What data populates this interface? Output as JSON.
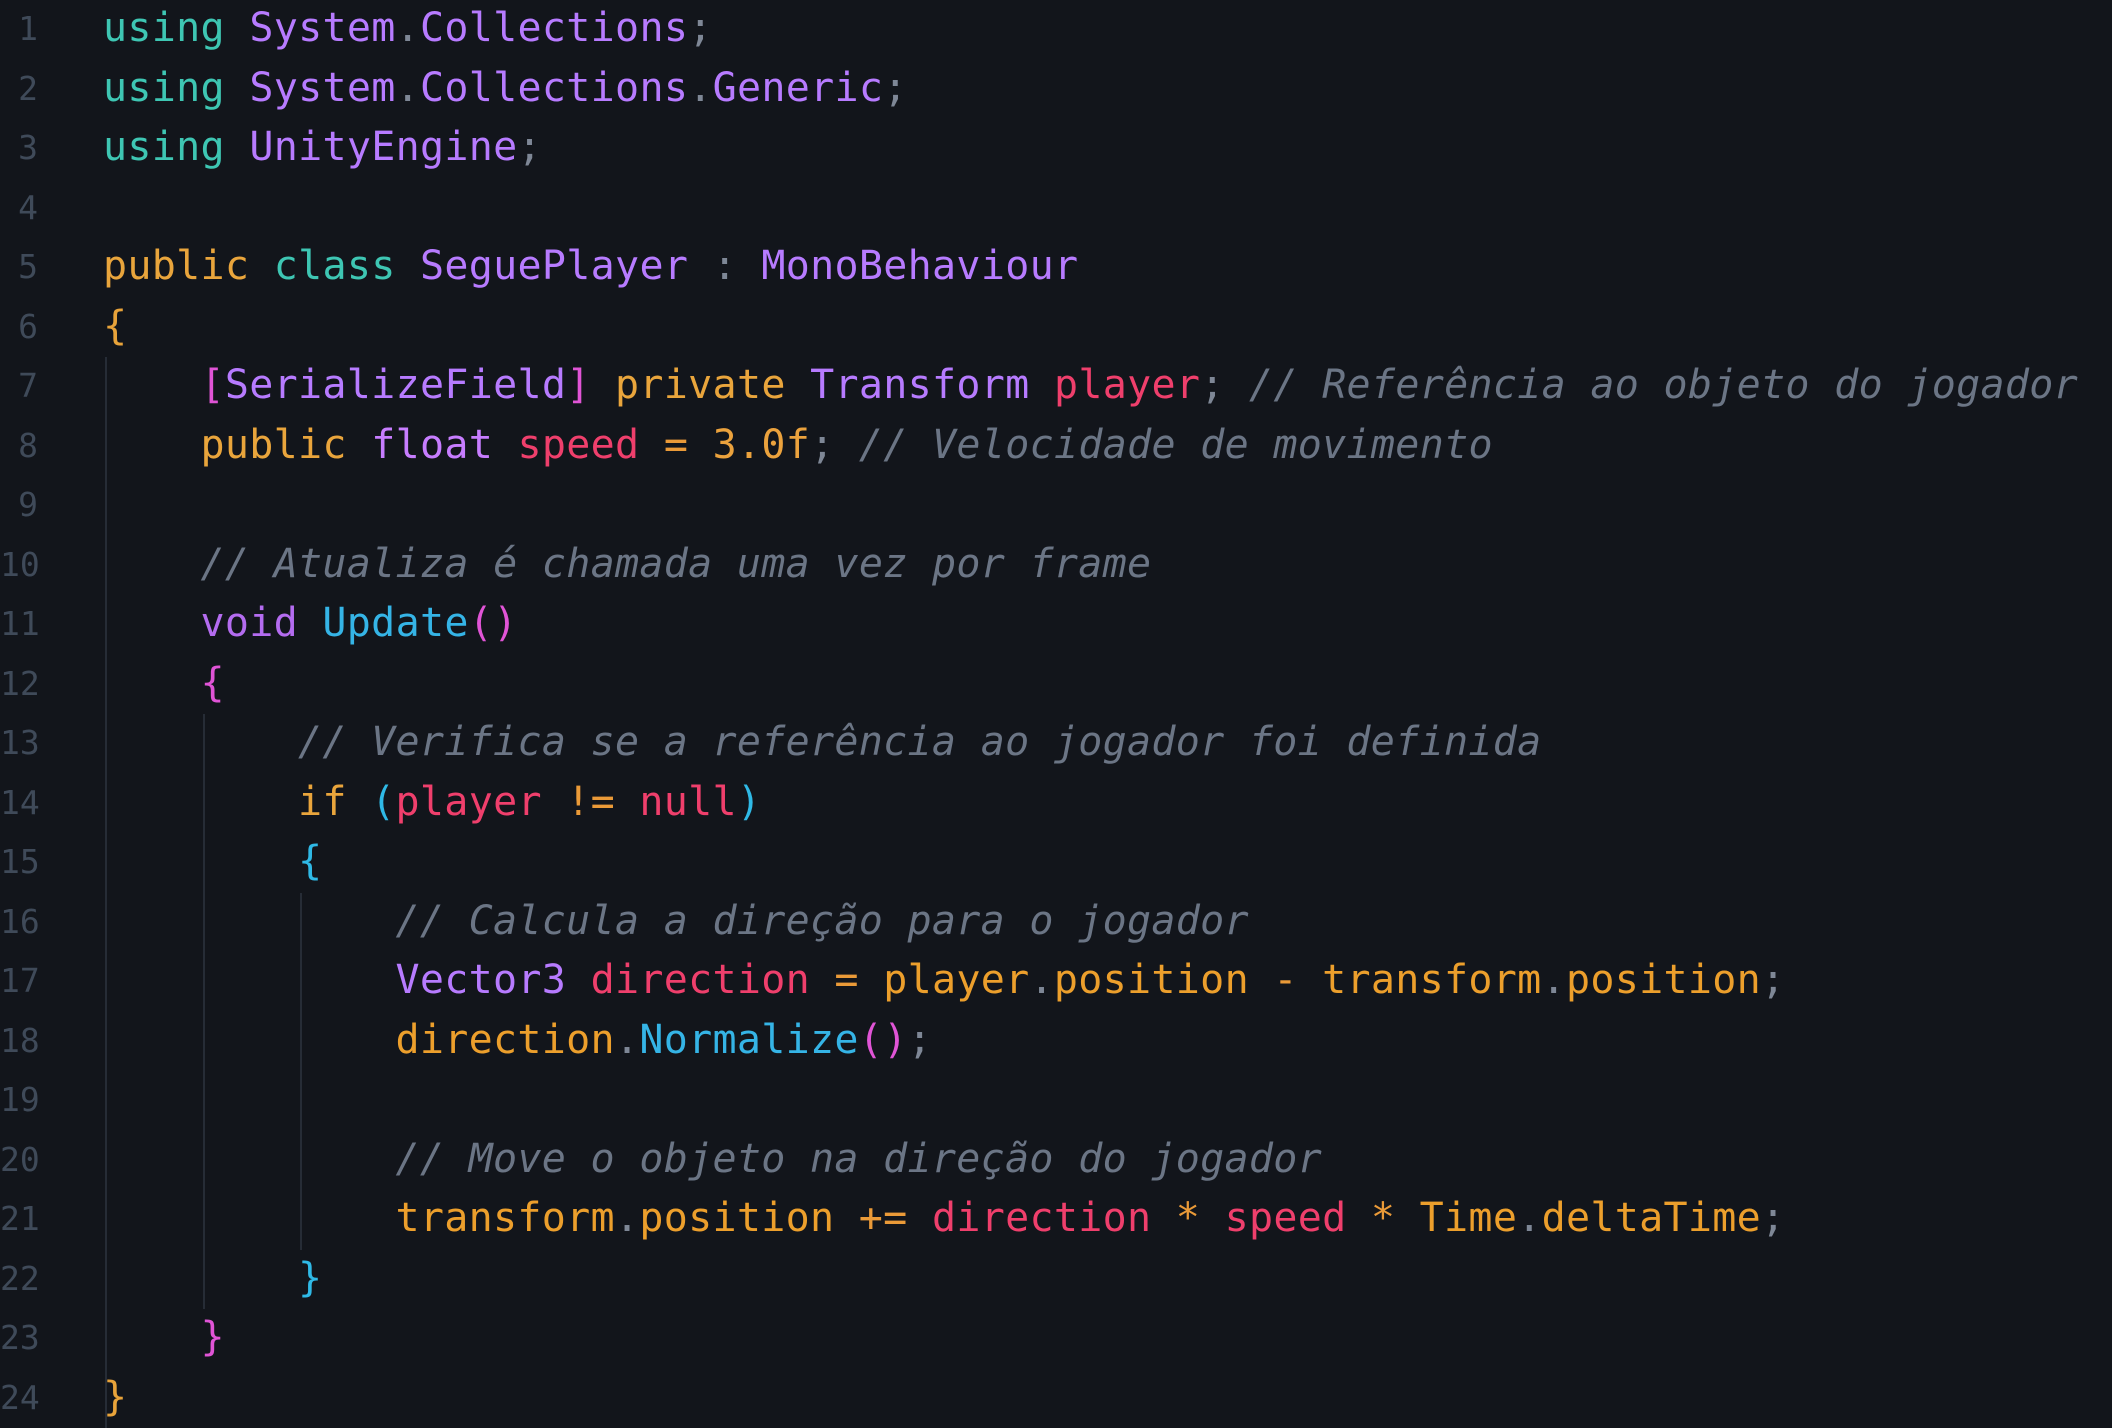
{
  "colors": {
    "background": "#12151b",
    "line_number": "#3f4a59",
    "comment": "#6b7585",
    "keyword_orange": "#e9a53c",
    "keyword_teal": "#3ec6b3",
    "type_purple": "#b77bff",
    "function_blue": "#35b4e6",
    "variable_red": "#ef3f6c",
    "property_orange": "#ec9f2c"
  },
  "lines": [
    {
      "n": "1",
      "indent": 0,
      "tokens": [
        [
          "using",
          "tk-kw-teal"
        ],
        [
          " ",
          "tk-plain"
        ],
        [
          "System",
          "tk-type"
        ],
        [
          ".",
          "tk-punc"
        ],
        [
          "Collections",
          "tk-type"
        ],
        [
          ";",
          "tk-punc"
        ]
      ]
    },
    {
      "n": "2",
      "indent": 0,
      "tokens": [
        [
          "using",
          "tk-kw-teal"
        ],
        [
          " ",
          "tk-plain"
        ],
        [
          "System",
          "tk-type"
        ],
        [
          ".",
          "tk-punc"
        ],
        [
          "Collections",
          "tk-type"
        ],
        [
          ".",
          "tk-punc"
        ],
        [
          "Generic",
          "tk-type"
        ],
        [
          ";",
          "tk-punc"
        ]
      ]
    },
    {
      "n": "3",
      "indent": 0,
      "tokens": [
        [
          "using",
          "tk-kw-teal"
        ],
        [
          " ",
          "tk-plain"
        ],
        [
          "UnityEngine",
          "tk-type"
        ],
        [
          ";",
          "tk-punc"
        ]
      ]
    },
    {
      "n": "4",
      "indent": 0,
      "tokens": []
    },
    {
      "n": "5",
      "indent": 0,
      "tokens": [
        [
          "public",
          "tk-kw-orange"
        ],
        [
          " ",
          "tk-plain"
        ],
        [
          "class",
          "tk-kw-teal"
        ],
        [
          " ",
          "tk-plain"
        ],
        [
          "SeguePlayer",
          "tk-type"
        ],
        [
          " ",
          "tk-plain"
        ],
        [
          ":",
          "tk-punc"
        ],
        [
          " ",
          "tk-plain"
        ],
        [
          "MonoBehaviour",
          "tk-type"
        ]
      ]
    },
    {
      "n": "6",
      "indent": 0,
      "tokens": [
        [
          "{",
          "tk-brace-y"
        ]
      ]
    },
    {
      "n": "7",
      "indent": 1,
      "tokens": [
        [
          "[",
          "tk-brace-m"
        ],
        [
          "SerializeField",
          "tk-type"
        ],
        [
          "]",
          "tk-brace-m"
        ],
        [
          " ",
          "tk-plain"
        ],
        [
          "private",
          "tk-kw-orange"
        ],
        [
          " ",
          "tk-plain"
        ],
        [
          "Transform",
          "tk-type"
        ],
        [
          " ",
          "tk-plain"
        ],
        [
          "player",
          "tk-var"
        ],
        [
          ";",
          "tk-punc"
        ],
        [
          " ",
          "tk-plain"
        ],
        [
          "// Referência ao objeto do jogador",
          "tk-comment"
        ]
      ]
    },
    {
      "n": "8",
      "indent": 1,
      "tokens": [
        [
          "public",
          "tk-kw-orange"
        ],
        [
          " ",
          "tk-plain"
        ],
        [
          "float",
          "tk-kw-purple"
        ],
        [
          " ",
          "tk-plain"
        ],
        [
          "speed",
          "tk-var"
        ],
        [
          " ",
          "tk-plain"
        ],
        [
          "=",
          "tk-op"
        ],
        [
          " ",
          "tk-plain"
        ],
        [
          "3.0f",
          "tk-num"
        ],
        [
          ";",
          "tk-punc"
        ],
        [
          " ",
          "tk-plain"
        ],
        [
          "// Velocidade de movimento",
          "tk-comment"
        ]
      ]
    },
    {
      "n": "9",
      "indent": 1,
      "tokens": []
    },
    {
      "n": "10",
      "indent": 1,
      "tokens": [
        [
          "// Atualiza é chamada uma vez por frame",
          "tk-comment"
        ]
      ]
    },
    {
      "n": "11",
      "indent": 1,
      "tokens": [
        [
          "void",
          "tk-kw-violet"
        ],
        [
          " ",
          "tk-plain"
        ],
        [
          "Update",
          "tk-fn"
        ],
        [
          "()",
          "tk-brace-m"
        ]
      ]
    },
    {
      "n": "12",
      "indent": 1,
      "tokens": [
        [
          "{",
          "tk-brace-m"
        ]
      ]
    },
    {
      "n": "13",
      "indent": 2,
      "tokens": [
        [
          "// Verifica se a referência ao jogador foi definida",
          "tk-comment"
        ]
      ]
    },
    {
      "n": "14",
      "indent": 2,
      "tokens": [
        [
          "if",
          "tk-kw-orange"
        ],
        [
          " ",
          "tk-plain"
        ],
        [
          "(",
          "tk-brace-c"
        ],
        [
          "player",
          "tk-var"
        ],
        [
          " ",
          "tk-plain"
        ],
        [
          "!=",
          "tk-op"
        ],
        [
          " ",
          "tk-plain"
        ],
        [
          "null",
          "tk-var"
        ],
        [
          ")",
          "tk-brace-c"
        ]
      ]
    },
    {
      "n": "15",
      "indent": 2,
      "tokens": [
        [
          "{",
          "tk-brace-c"
        ]
      ]
    },
    {
      "n": "16",
      "indent": 3,
      "tokens": [
        [
          "// Calcula a direção para o jogador",
          "tk-comment"
        ]
      ]
    },
    {
      "n": "17",
      "indent": 3,
      "tokens": [
        [
          "Vector3",
          "tk-type"
        ],
        [
          " ",
          "tk-plain"
        ],
        [
          "direction",
          "tk-var"
        ],
        [
          " ",
          "tk-plain"
        ],
        [
          "=",
          "tk-op"
        ],
        [
          " ",
          "tk-plain"
        ],
        [
          "player",
          "tk-prop"
        ],
        [
          ".",
          "tk-punc"
        ],
        [
          "position",
          "tk-prop"
        ],
        [
          " ",
          "tk-plain"
        ],
        [
          "-",
          "tk-op"
        ],
        [
          " ",
          "tk-plain"
        ],
        [
          "transform",
          "tk-prop"
        ],
        [
          ".",
          "tk-punc"
        ],
        [
          "position",
          "tk-prop"
        ],
        [
          ";",
          "tk-punc"
        ]
      ]
    },
    {
      "n": "18",
      "indent": 3,
      "tokens": [
        [
          "direction",
          "tk-prop"
        ],
        [
          ".",
          "tk-punc"
        ],
        [
          "Normalize",
          "tk-fn"
        ],
        [
          "()",
          "tk-brace-m"
        ],
        [
          ";",
          "tk-punc"
        ]
      ]
    },
    {
      "n": "19",
      "indent": 3,
      "tokens": []
    },
    {
      "n": "20",
      "indent": 3,
      "tokens": [
        [
          "// Move o objeto na direção do jogador",
          "tk-comment"
        ]
      ]
    },
    {
      "n": "21",
      "indent": 3,
      "tokens": [
        [
          "transform",
          "tk-prop"
        ],
        [
          ".",
          "tk-punc"
        ],
        [
          "position",
          "tk-prop"
        ],
        [
          " ",
          "tk-plain"
        ],
        [
          "+=",
          "tk-op"
        ],
        [
          " ",
          "tk-plain"
        ],
        [
          "direction",
          "tk-var"
        ],
        [
          " ",
          "tk-plain"
        ],
        [
          "*",
          "tk-op"
        ],
        [
          " ",
          "tk-plain"
        ],
        [
          "speed",
          "tk-var"
        ],
        [
          " ",
          "tk-plain"
        ],
        [
          "*",
          "tk-op"
        ],
        [
          " ",
          "tk-plain"
        ],
        [
          "Time",
          "tk-prop"
        ],
        [
          ".",
          "tk-punc"
        ],
        [
          "deltaTime",
          "tk-prop"
        ],
        [
          ";",
          "tk-punc"
        ]
      ]
    },
    {
      "n": "22",
      "indent": 2,
      "tokens": [
        [
          "}",
          "tk-brace-c"
        ]
      ]
    },
    {
      "n": "23",
      "indent": 1,
      "tokens": [
        [
          "}",
          "tk-brace-m"
        ]
      ]
    },
    {
      "n": "24",
      "indent": 0,
      "tokens": [
        [
          "}",
          "tk-brace-y"
        ]
      ]
    }
  ]
}
